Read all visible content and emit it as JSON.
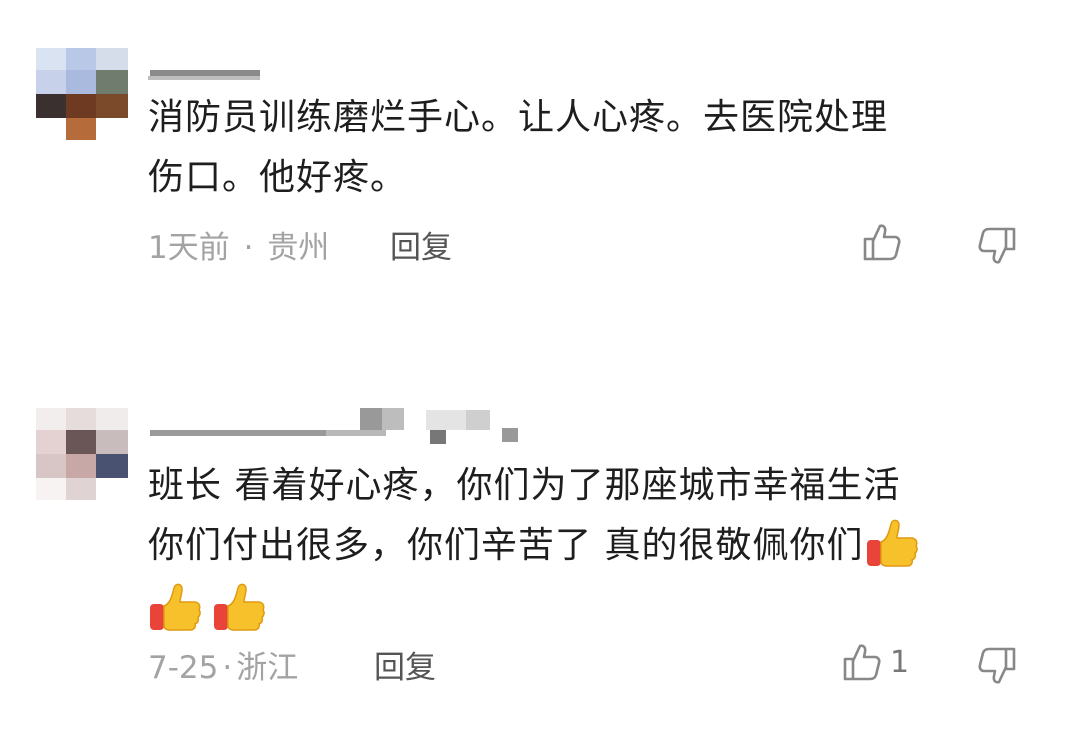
{
  "comments": [
    {
      "text_lines": [
        "消防员训练磨烂手心。让人心疼。去医院处理",
        "伤口。他好疼。"
      ],
      "date": "1天前",
      "separator": "·",
      "location": "贵州",
      "reply_label": "回复",
      "like_count": ""
    },
    {
      "text_lines": [
        "班长 看着好心疼，你们为了那座城市幸福生活",
        "你们付出很多，你们辛苦了 真的很敬佩你们"
      ],
      "emoji_count": 3,
      "emoji_name": "thumbs-up-emoji",
      "date": "7-25",
      "separator": "·",
      "location": "浙江",
      "reply_label": "回复",
      "like_count": "1"
    }
  ],
  "icons": {
    "like": "thumbs-up-outline-icon",
    "dislike": "thumbs-down-outline-icon"
  },
  "colors": {
    "text": "#1e1e1e",
    "meta": "#a3a3a3",
    "reply": "#555555",
    "icon": "#888888"
  }
}
